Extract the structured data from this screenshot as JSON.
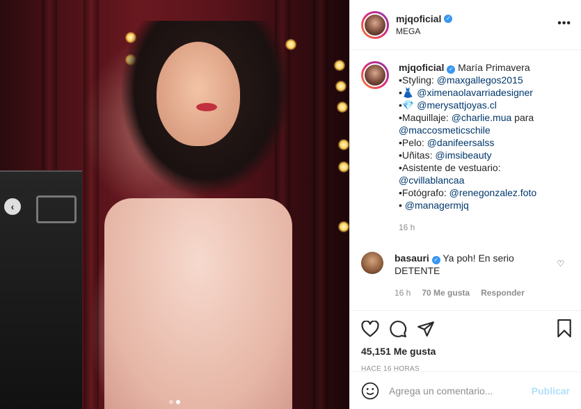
{
  "header": {
    "username": "mjqoficial",
    "subtitle": "MEGA",
    "more_icon": "more-horizontal-icon"
  },
  "caption": {
    "username": "mjqoficial",
    "title": "María Primavera",
    "lines": [
      {
        "prefix": "•Styling: ",
        "mention": "@maxgallegos2015"
      },
      {
        "prefix": "•👗 ",
        "mention": "@ximenaolavarriadesigner"
      },
      {
        "prefix": "•💎 ",
        "mention": "@merysattjoyas.cl"
      },
      {
        "prefix": "•Maquillaje: ",
        "mention": "@charlie.mua",
        "suffix": " para"
      },
      {
        "prefix": "",
        "mention": "@maccosmeticschile"
      },
      {
        "prefix": "•Pelo: ",
        "mention": "@danifeersalss"
      },
      {
        "prefix": "•Uñitas: ",
        "mention": "@imsibeauty"
      },
      {
        "prefix": "•Asistente de vestuario:",
        "mention": ""
      },
      {
        "prefix": "",
        "mention": "@cvillablancaa"
      },
      {
        "prefix": "•Fotógrafo: ",
        "mention": "@renegonzalez.foto"
      },
      {
        "prefix": "• ",
        "mention": "@managermjq"
      }
    ],
    "time": "16 h"
  },
  "comment": {
    "username": "basauri",
    "text": "Ya poh! En serio DETENTE",
    "time": "16 h",
    "likes": "70 Me gusta",
    "reply": "Responder"
  },
  "actions": {
    "likes": "45,151 Me gusta",
    "timestamp": "HACE 16 HORAS"
  },
  "add_comment": {
    "placeholder": "Agrega un comentario...",
    "publish": "Publicar"
  },
  "media": {
    "prev_icon": "chevron-left-icon",
    "slides": 2,
    "active_slide": 2
  }
}
